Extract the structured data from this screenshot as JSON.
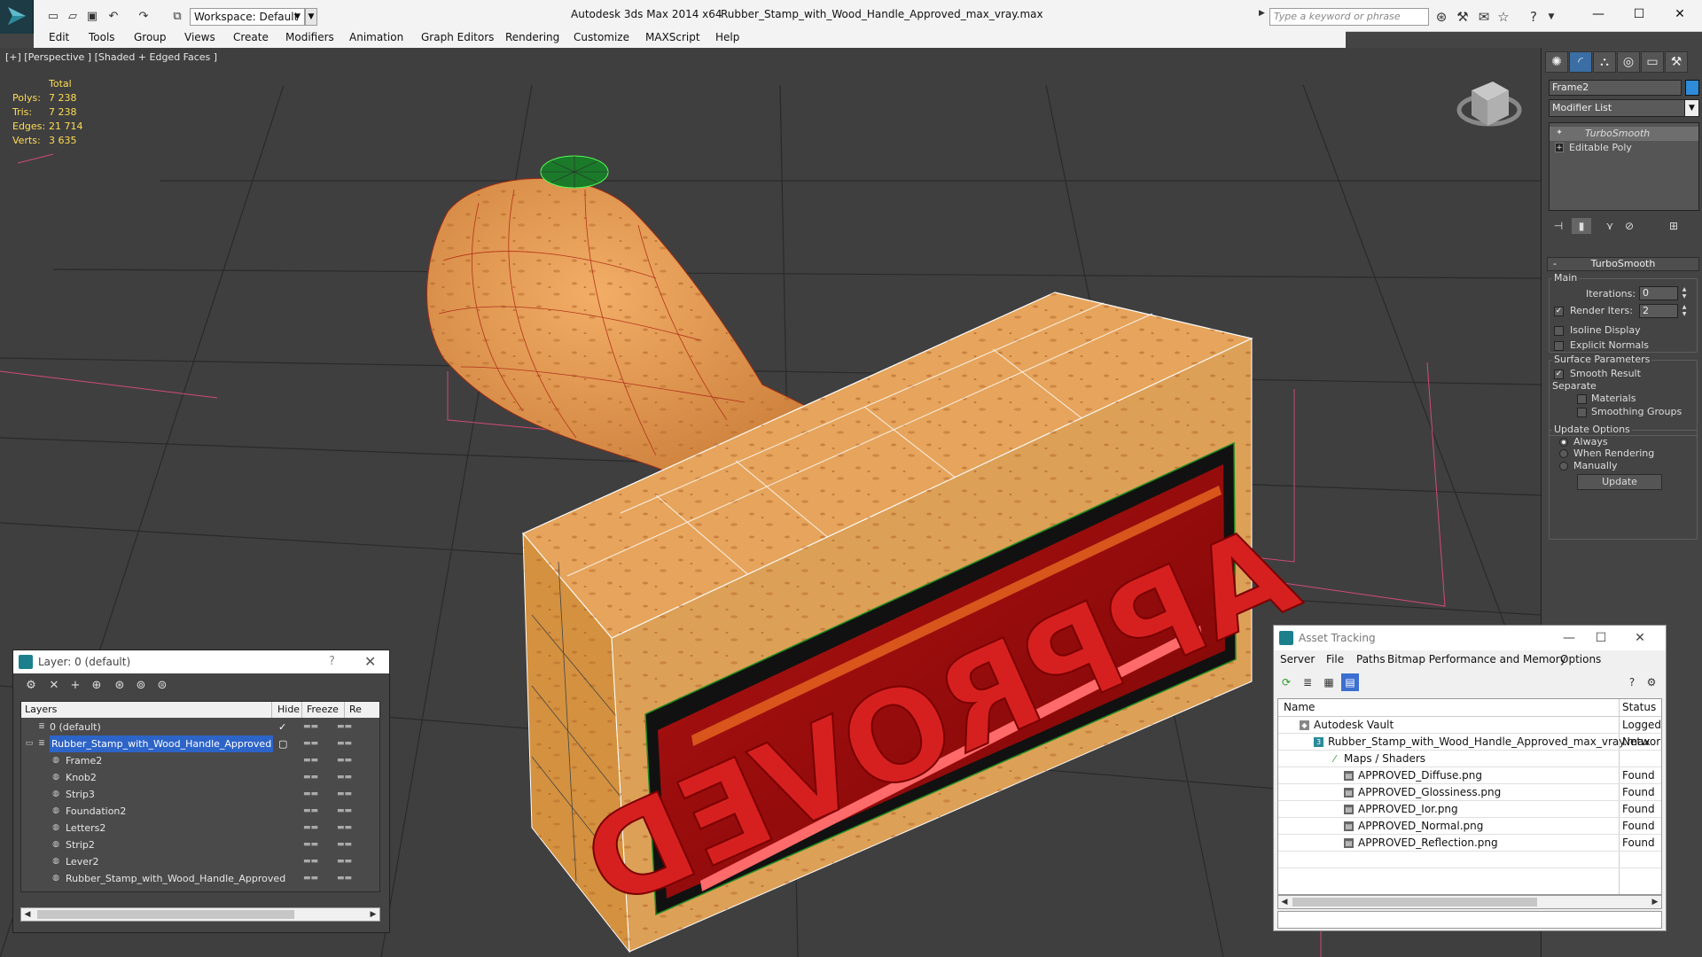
{
  "titlebar": {
    "workspace": "Workspace: Default",
    "app_title": "Autodesk 3ds Max  2014 x64",
    "file_title": "Rubber_Stamp_with_Wood_Handle_Approved_max_vray.max",
    "search_placeholder": "Type a keyword or phrase"
  },
  "menu": [
    "Edit",
    "Tools",
    "Group",
    "Views",
    "Create",
    "Modifiers",
    "Animation",
    "Graph Editors",
    "Rendering",
    "Customize",
    "MAXScript",
    "Help"
  ],
  "viewport": {
    "label": "[+] [Perspective ] [Shaded + Edged Faces ]",
    "stats": {
      "header": "Total",
      "rows": [
        {
          "label": "Polys:",
          "value": "7 238"
        },
        {
          "label": "Tris:",
          "value": "7 238"
        },
        {
          "label": "Edges:",
          "value": "21 714"
        },
        {
          "label": "Verts:",
          "value": "3 635"
        }
      ]
    },
    "stamp_text": "APPROVED"
  },
  "command_panel": {
    "object_name": "Frame2",
    "object_color": "#2e8bd9",
    "modifier_list": "Modifier List",
    "stack": [
      {
        "label": "TurboSmooth",
        "icon": "bulb-icon"
      },
      {
        "label": "Editable Poly",
        "icon": "plus-icon"
      }
    ],
    "rollout": "TurboSmooth",
    "main_group": "Main",
    "iterations_label": "Iterations:",
    "iterations": "0",
    "render_iters_label": "Render Iters:",
    "render_iters": "2",
    "isoline": "Isoline Display",
    "explicit_normals": "Explicit Normals",
    "surface_group": "Surface Parameters",
    "smooth_result": "Smooth Result",
    "separate": "Separate",
    "materials": "Materials",
    "smoothing_groups": "Smoothing Groups",
    "update_group": "Update Options",
    "always": "Always",
    "when_rendering": "When Rendering",
    "manually": "Manually",
    "update_btn": "Update"
  },
  "layer_window": {
    "title": "Layer: 0 (default)",
    "col_layers": "Layers",
    "col_hide": "Hide",
    "col_freeze": "Freeze",
    "col_render": "Re",
    "rows": [
      {
        "label": "0 (default)",
        "level": 0
      },
      {
        "label": "Rubber_Stamp_with_Wood_Handle_Approved",
        "level": 0
      },
      {
        "label": "Frame2",
        "level": 1
      },
      {
        "label": "Knob2",
        "level": 1
      },
      {
        "label": "Strip3",
        "level": 1
      },
      {
        "label": "Foundation2",
        "level": 1
      },
      {
        "label": "Letters2",
        "level": 1
      },
      {
        "label": "Strip2",
        "level": 1
      },
      {
        "label": "Lever2",
        "level": 1
      },
      {
        "label": "Rubber_Stamp_with_Wood_Handle_Approved",
        "level": 1
      }
    ]
  },
  "asset_tracking": {
    "title": "Asset Tracking",
    "menu": [
      "Server",
      "File",
      "Paths",
      "Bitmap Performance and Memory",
      "Options"
    ],
    "col_name": "Name",
    "col_status": "Status",
    "rows": [
      {
        "name": "Autodesk Vault",
        "status": "Logged O",
        "level": 0
      },
      {
        "name": "Rubber_Stamp_with_Wood_Handle_Approved_max_vray.max",
        "status": "Network",
        "level": 1
      },
      {
        "name": "Maps / Shaders",
        "status": "",
        "level": 2
      },
      {
        "name": "APPROVED_Diffuse.png",
        "status": "Found",
        "level": 3
      },
      {
        "name": "APPROVED_Glossiness.png",
        "status": "Found",
        "level": 3
      },
      {
        "name": "APPROVED_Ior.png",
        "status": "Found",
        "level": 3
      },
      {
        "name": "APPROVED_Normal.png",
        "status": "Found",
        "level": 3
      },
      {
        "name": "APPROVED_Reflection.png",
        "status": "Found",
        "level": 3
      }
    ]
  }
}
